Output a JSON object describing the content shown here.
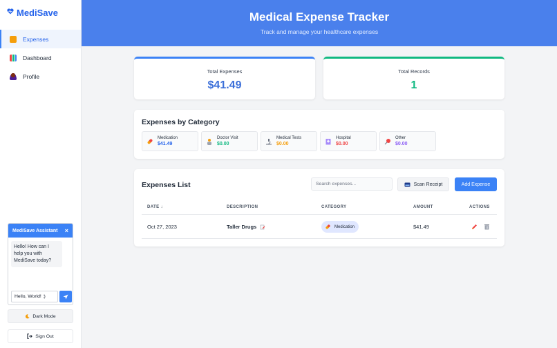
{
  "brand": {
    "name": "MediSave"
  },
  "sidebar": {
    "items": [
      {
        "label": "Expenses"
      },
      {
        "label": "Dashboard"
      },
      {
        "label": "Profile"
      }
    ]
  },
  "chat": {
    "title": "MediSave Assistant",
    "close": "×",
    "message": "Hello! How can I help you with MediSave today?",
    "input_value": "Hello, World! :)"
  },
  "buttons": {
    "dark_mode": "Dark Mode",
    "sign_out": "Sign Out"
  },
  "header": {
    "title": "Medical Expense Tracker",
    "subtitle": "Track and manage your healthcare expenses"
  },
  "stats": {
    "total_label": "Total Expenses",
    "total_value": "$41.49",
    "records_label": "Total Records",
    "records_value": "1"
  },
  "categories": {
    "title": "Expenses by Category",
    "items": [
      {
        "name": "Medication",
        "amount": "$41.49",
        "color": "#2563eb"
      },
      {
        "name": "Doctor Visit",
        "amount": "$0.00",
        "color": "#10b981"
      },
      {
        "name": "Medical Tests",
        "amount": "$0.00",
        "color": "#f59e0b"
      },
      {
        "name": "Hospital",
        "amount": "$0.00",
        "color": "#ef4444"
      },
      {
        "name": "Other",
        "amount": "$0.00",
        "color": "#8b5cf6"
      }
    ]
  },
  "list": {
    "title": "Expenses List",
    "search_placeholder": "Search expenses...",
    "scan_label": "Scan Receipt",
    "add_label": "Add Expense",
    "columns": {
      "date": "DATE ↓",
      "description": "DESCRIPTION",
      "category": "CATEGORY",
      "amount": "AMOUNT",
      "actions": "ACTIONS"
    },
    "rows": [
      {
        "date": "Oct 27, 2023",
        "description": "Taller Drugs",
        "category": "Medication",
        "amount": "$41.49"
      }
    ]
  },
  "colors": {
    "accent": "#3b82f6",
    "header_bg": "#4a80ec",
    "success": "#10b981"
  }
}
